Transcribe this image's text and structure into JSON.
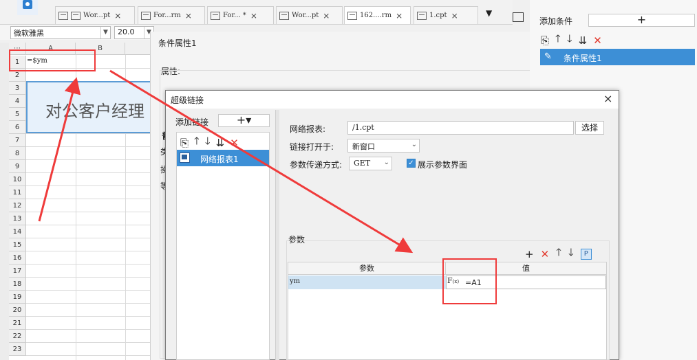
{
  "tabs": [
    {
      "label": "Wor...pt"
    },
    {
      "label": "For...rm"
    },
    {
      "label": "For...  *"
    },
    {
      "label": "Wor...pt"
    },
    {
      "label": "162....rm"
    },
    {
      "label": "1.cpt"
    }
  ],
  "format_bar": {
    "font": "微软雅黑",
    "size": "20.0"
  },
  "sheet": {
    "columns": [
      "A",
      "B"
    ],
    "rows": [
      "1",
      "2",
      "3",
      "4",
      "5",
      "6",
      "7",
      "8",
      "9",
      "10",
      "11",
      "12",
      "13",
      "14",
      "15",
      "16",
      "17",
      "18",
      "19",
      "20",
      "21",
      "22",
      "23"
    ],
    "cell_a1": "=$ym",
    "merged_text": "对公客户经理"
  },
  "condition_dialog": {
    "title": "条件属性1",
    "attr_label": "属性:",
    "side_letters": [
      "普",
      "类",
      "操",
      "等"
    ]
  },
  "right_panel": {
    "add_condition_label": "添加条件",
    "add_button": "+",
    "item_label": "条件属性1"
  },
  "hyperlink_dialog": {
    "title": "超级链接",
    "close": "×",
    "add_link_label": "添加链接",
    "add_link_btn": "+▾",
    "link_item_label": "网络报表1",
    "report_label": "网络报表:",
    "report_value": "/1.cpt",
    "choose_button": "选择",
    "open_in_label": "链接打开于:",
    "open_in_value": "新窗口",
    "transfer_label": "参数传递方式:",
    "transfer_value": "GET",
    "show_param_label": "展示参数界面",
    "show_param_checked": true,
    "params_label": "参数",
    "table_headers": {
      "param": "参数",
      "value": "值"
    },
    "table_rows": [
      {
        "param": "ym",
        "value": "=A1"
      }
    ]
  },
  "colors": {
    "accent": "#3d8fd6",
    "annotation_red": "#ef3b3b"
  }
}
